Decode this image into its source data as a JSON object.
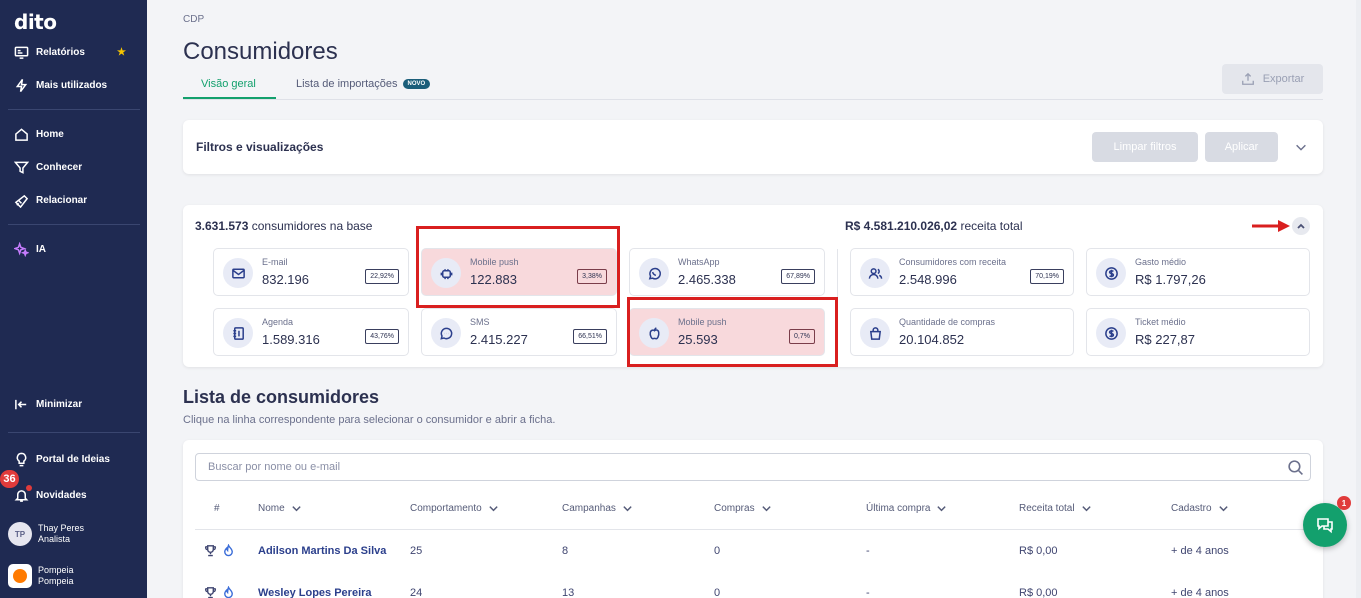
{
  "sidebar": {
    "logo": "dito",
    "items": [
      {
        "label": "Relatórios",
        "icon": "report-icon"
      },
      {
        "label": "Mais utilizados",
        "icon": "bolt-icon"
      },
      {
        "label": "Home",
        "icon": "home-icon"
      },
      {
        "label": "Conhecer",
        "icon": "filter-icon"
      },
      {
        "label": "Relacionar",
        "icon": "megaphone-icon"
      },
      {
        "label": "IA",
        "icon": "sparkle-icon"
      },
      {
        "label": "Minimizar",
        "icon": "collapse-left-icon"
      },
      {
        "label": "Portal de Ideias",
        "icon": "lightbulb-icon"
      },
      {
        "label": "Novidades",
        "icon": "bell-icon"
      }
    ],
    "star": "★",
    "notifications_badge": "36",
    "user": {
      "initials": "TP",
      "name": "Thay Peres",
      "role": "Analista"
    },
    "org": {
      "name": "Pompeia",
      "sub": "Pompeia"
    }
  },
  "header": {
    "breadcrumb": "CDP",
    "title": "Consumidores",
    "tabs": [
      {
        "label": "Visão geral",
        "active": true
      },
      {
        "label": "Lista de importações",
        "badge": "NOVO"
      }
    ],
    "export_label": "Exportar"
  },
  "filters": {
    "label": "Filtros e visualizações",
    "clear_label": "Limpar filtros",
    "apply_label": "Aplicar"
  },
  "summary": {
    "consumers_count": "3.631.573",
    "consumers_text": "consumidores na base",
    "revenue_total": "R$ 4.581.210.026,02",
    "revenue_text": "receita total"
  },
  "channels": [
    {
      "label": "E-mail",
      "value": "832.196",
      "pct": "22,92%",
      "icon": "mail-icon"
    },
    {
      "label": "Mobile push",
      "value": "122.883",
      "pct": "3,38%",
      "icon": "android-icon"
    },
    {
      "label": "WhatsApp",
      "value": "2.465.338",
      "pct": "67,89%",
      "icon": "whatsapp-icon"
    },
    {
      "label": "Agenda",
      "value": "1.589.316",
      "pct": "43,76%",
      "icon": "contacts-icon"
    },
    {
      "label": "SMS",
      "value": "2.415.227",
      "pct": "66,51%",
      "icon": "sms-icon"
    },
    {
      "label": "Mobile push",
      "value": "25.593",
      "pct": "0,7%",
      "icon": "apple-icon"
    }
  ],
  "metrics": [
    {
      "label": "Consumidores com receita",
      "value": "2.548.996",
      "pct": "70,19%",
      "icon": "users-icon"
    },
    {
      "label": "Gasto médio",
      "value": "R$ 1.797,26",
      "icon": "dollar-icon"
    },
    {
      "label": "Quantidade de compras",
      "value": "20.104.852",
      "icon": "bag-icon"
    },
    {
      "label": "Ticket médio",
      "value": "R$ 227,87",
      "icon": "dollar-icon"
    }
  ],
  "list": {
    "title": "Lista de consumidores",
    "subtitle": "Clique na linha correspondente para selecionar o consumidor e abrir a ficha.",
    "search_placeholder": "Buscar por nome ou e-mail",
    "columns": [
      "#",
      "Nome",
      "Comportamento",
      "Campanhas",
      "Compras",
      "Última compra",
      "Receita total",
      "Cadastro"
    ],
    "rows": [
      {
        "name": "Adilson Martins Da Silva",
        "comportamento": "25",
        "campanhas": "8",
        "compras": "0",
        "ultima": "-",
        "receita": "R$ 0,00",
        "cadastro": "+ de 4 anos"
      },
      {
        "name": "Wesley Lopes Pereira",
        "comportamento": "24",
        "campanhas": "13",
        "compras": "0",
        "ultima": "-",
        "receita": "R$ 0,00",
        "cadastro": "+ de 4 anos"
      }
    ]
  },
  "chat": {
    "badge": "1"
  },
  "colors": {
    "sidebar": "#1f2a52",
    "accent": "#13a06d",
    "highlight_box": "#d91f1f"
  }
}
